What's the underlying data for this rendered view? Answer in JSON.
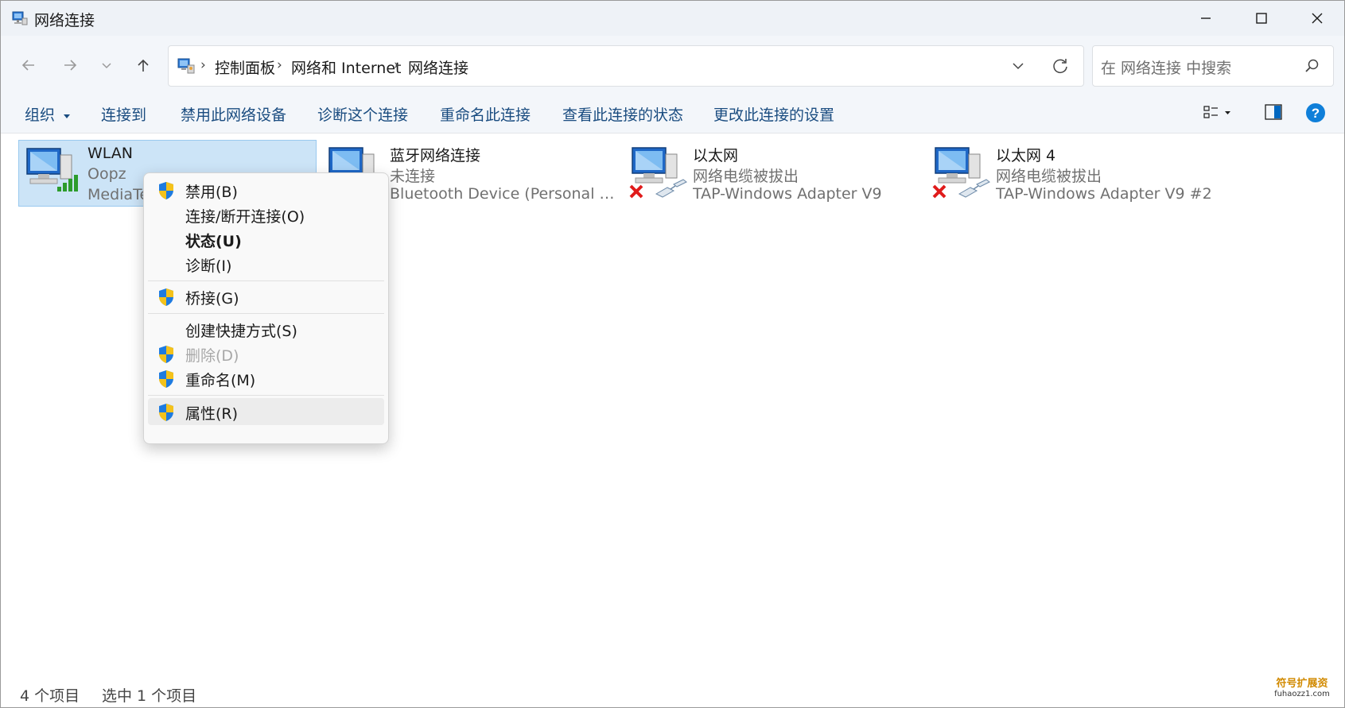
{
  "window": {
    "title": "网络连接",
    "minimize_icon": "minimize-icon",
    "maximize_icon": "maximize-icon",
    "close_icon": "close-icon"
  },
  "nav": {
    "breadcrumb": [
      "控制面板",
      "网络和 Internet",
      "网络连接"
    ],
    "search_placeholder": "在 网络连接 中搜索"
  },
  "commands": {
    "organize": "组织",
    "items": [
      "连接到",
      "禁用此网络设备",
      "诊断这个连接",
      "重命名此连接",
      "查看此连接的状态",
      "更改此连接的设置"
    ]
  },
  "connections": [
    {
      "name": "WLAN",
      "status": "Oopz",
      "device": "MediaTe",
      "type": "wifi",
      "selected": true,
      "disconnected": false
    },
    {
      "name": "蓝牙网络连接",
      "status": "未连接",
      "device": "Bluetooth Device (Personal Are...",
      "type": "bluetooth",
      "selected": false,
      "disconnected": false
    },
    {
      "name": "以太网",
      "status": "网络电缆被拔出",
      "device": "TAP-Windows Adapter V9",
      "type": "ethernet",
      "selected": false,
      "disconnected": true
    },
    {
      "name": "以太网 4",
      "status": "网络电缆被拔出",
      "device": "TAP-Windows Adapter V9 #2",
      "type": "ethernet",
      "selected": false,
      "disconnected": true
    }
  ],
  "context_menu": [
    {
      "label": "禁用(B)",
      "shield": true
    },
    {
      "label": "连接/断开连接(O)",
      "shield": false
    },
    {
      "label": "状态(U)",
      "shield": false,
      "bold": true
    },
    {
      "label": "诊断(I)",
      "shield": false
    },
    {
      "label": "桥接(G)",
      "shield": true
    },
    {
      "label": "创建快捷方式(S)",
      "shield": false
    },
    {
      "label": "删除(D)",
      "shield": true,
      "disabled": true
    },
    {
      "label": "重命名(M)",
      "shield": true
    },
    {
      "label": "属性(R)",
      "shield": true,
      "hover": true
    }
  ],
  "status_bar": {
    "item_count": "4 个项目",
    "selected_count": "选中 1 个项目"
  },
  "watermark": {
    "line1": "符号扩展资",
    "line2": "fuhaozz1.com"
  },
  "colors": {
    "accent": "#0067c0",
    "selection_bg": "#cce4f7",
    "command_text": "#1a4c80",
    "error_red": "#e01b1b"
  }
}
